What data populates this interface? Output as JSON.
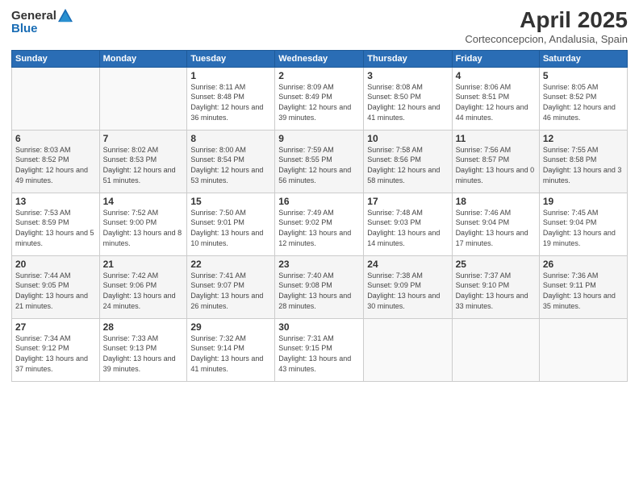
{
  "header": {
    "logo_general": "General",
    "logo_blue": "Blue",
    "title": "April 2025",
    "subtitle": "Corteconcepcion, Andalusia, Spain"
  },
  "days_of_week": [
    "Sunday",
    "Monday",
    "Tuesday",
    "Wednesday",
    "Thursday",
    "Friday",
    "Saturday"
  ],
  "weeks": [
    [
      {
        "day": "",
        "info": ""
      },
      {
        "day": "",
        "info": ""
      },
      {
        "day": "1",
        "info": "Sunrise: 8:11 AM\nSunset: 8:48 PM\nDaylight: 12 hours and 36 minutes."
      },
      {
        "day": "2",
        "info": "Sunrise: 8:09 AM\nSunset: 8:49 PM\nDaylight: 12 hours and 39 minutes."
      },
      {
        "day": "3",
        "info": "Sunrise: 8:08 AM\nSunset: 8:50 PM\nDaylight: 12 hours and 41 minutes."
      },
      {
        "day": "4",
        "info": "Sunrise: 8:06 AM\nSunset: 8:51 PM\nDaylight: 12 hours and 44 minutes."
      },
      {
        "day": "5",
        "info": "Sunrise: 8:05 AM\nSunset: 8:52 PM\nDaylight: 12 hours and 46 minutes."
      }
    ],
    [
      {
        "day": "6",
        "info": "Sunrise: 8:03 AM\nSunset: 8:52 PM\nDaylight: 12 hours and 49 minutes."
      },
      {
        "day": "7",
        "info": "Sunrise: 8:02 AM\nSunset: 8:53 PM\nDaylight: 12 hours and 51 minutes."
      },
      {
        "day": "8",
        "info": "Sunrise: 8:00 AM\nSunset: 8:54 PM\nDaylight: 12 hours and 53 minutes."
      },
      {
        "day": "9",
        "info": "Sunrise: 7:59 AM\nSunset: 8:55 PM\nDaylight: 12 hours and 56 minutes."
      },
      {
        "day": "10",
        "info": "Sunrise: 7:58 AM\nSunset: 8:56 PM\nDaylight: 12 hours and 58 minutes."
      },
      {
        "day": "11",
        "info": "Sunrise: 7:56 AM\nSunset: 8:57 PM\nDaylight: 13 hours and 0 minutes."
      },
      {
        "day": "12",
        "info": "Sunrise: 7:55 AM\nSunset: 8:58 PM\nDaylight: 13 hours and 3 minutes."
      }
    ],
    [
      {
        "day": "13",
        "info": "Sunrise: 7:53 AM\nSunset: 8:59 PM\nDaylight: 13 hours and 5 minutes."
      },
      {
        "day": "14",
        "info": "Sunrise: 7:52 AM\nSunset: 9:00 PM\nDaylight: 13 hours and 8 minutes."
      },
      {
        "day": "15",
        "info": "Sunrise: 7:50 AM\nSunset: 9:01 PM\nDaylight: 13 hours and 10 minutes."
      },
      {
        "day": "16",
        "info": "Sunrise: 7:49 AM\nSunset: 9:02 PM\nDaylight: 13 hours and 12 minutes."
      },
      {
        "day": "17",
        "info": "Sunrise: 7:48 AM\nSunset: 9:03 PM\nDaylight: 13 hours and 14 minutes."
      },
      {
        "day": "18",
        "info": "Sunrise: 7:46 AM\nSunset: 9:04 PM\nDaylight: 13 hours and 17 minutes."
      },
      {
        "day": "19",
        "info": "Sunrise: 7:45 AM\nSunset: 9:04 PM\nDaylight: 13 hours and 19 minutes."
      }
    ],
    [
      {
        "day": "20",
        "info": "Sunrise: 7:44 AM\nSunset: 9:05 PM\nDaylight: 13 hours and 21 minutes."
      },
      {
        "day": "21",
        "info": "Sunrise: 7:42 AM\nSunset: 9:06 PM\nDaylight: 13 hours and 24 minutes."
      },
      {
        "day": "22",
        "info": "Sunrise: 7:41 AM\nSunset: 9:07 PM\nDaylight: 13 hours and 26 minutes."
      },
      {
        "day": "23",
        "info": "Sunrise: 7:40 AM\nSunset: 9:08 PM\nDaylight: 13 hours and 28 minutes."
      },
      {
        "day": "24",
        "info": "Sunrise: 7:38 AM\nSunset: 9:09 PM\nDaylight: 13 hours and 30 minutes."
      },
      {
        "day": "25",
        "info": "Sunrise: 7:37 AM\nSunset: 9:10 PM\nDaylight: 13 hours and 33 minutes."
      },
      {
        "day": "26",
        "info": "Sunrise: 7:36 AM\nSunset: 9:11 PM\nDaylight: 13 hours and 35 minutes."
      }
    ],
    [
      {
        "day": "27",
        "info": "Sunrise: 7:34 AM\nSunset: 9:12 PM\nDaylight: 13 hours and 37 minutes."
      },
      {
        "day": "28",
        "info": "Sunrise: 7:33 AM\nSunset: 9:13 PM\nDaylight: 13 hours and 39 minutes."
      },
      {
        "day": "29",
        "info": "Sunrise: 7:32 AM\nSunset: 9:14 PM\nDaylight: 13 hours and 41 minutes."
      },
      {
        "day": "30",
        "info": "Sunrise: 7:31 AM\nSunset: 9:15 PM\nDaylight: 13 hours and 43 minutes."
      },
      {
        "day": "",
        "info": ""
      },
      {
        "day": "",
        "info": ""
      },
      {
        "day": "",
        "info": ""
      }
    ]
  ]
}
